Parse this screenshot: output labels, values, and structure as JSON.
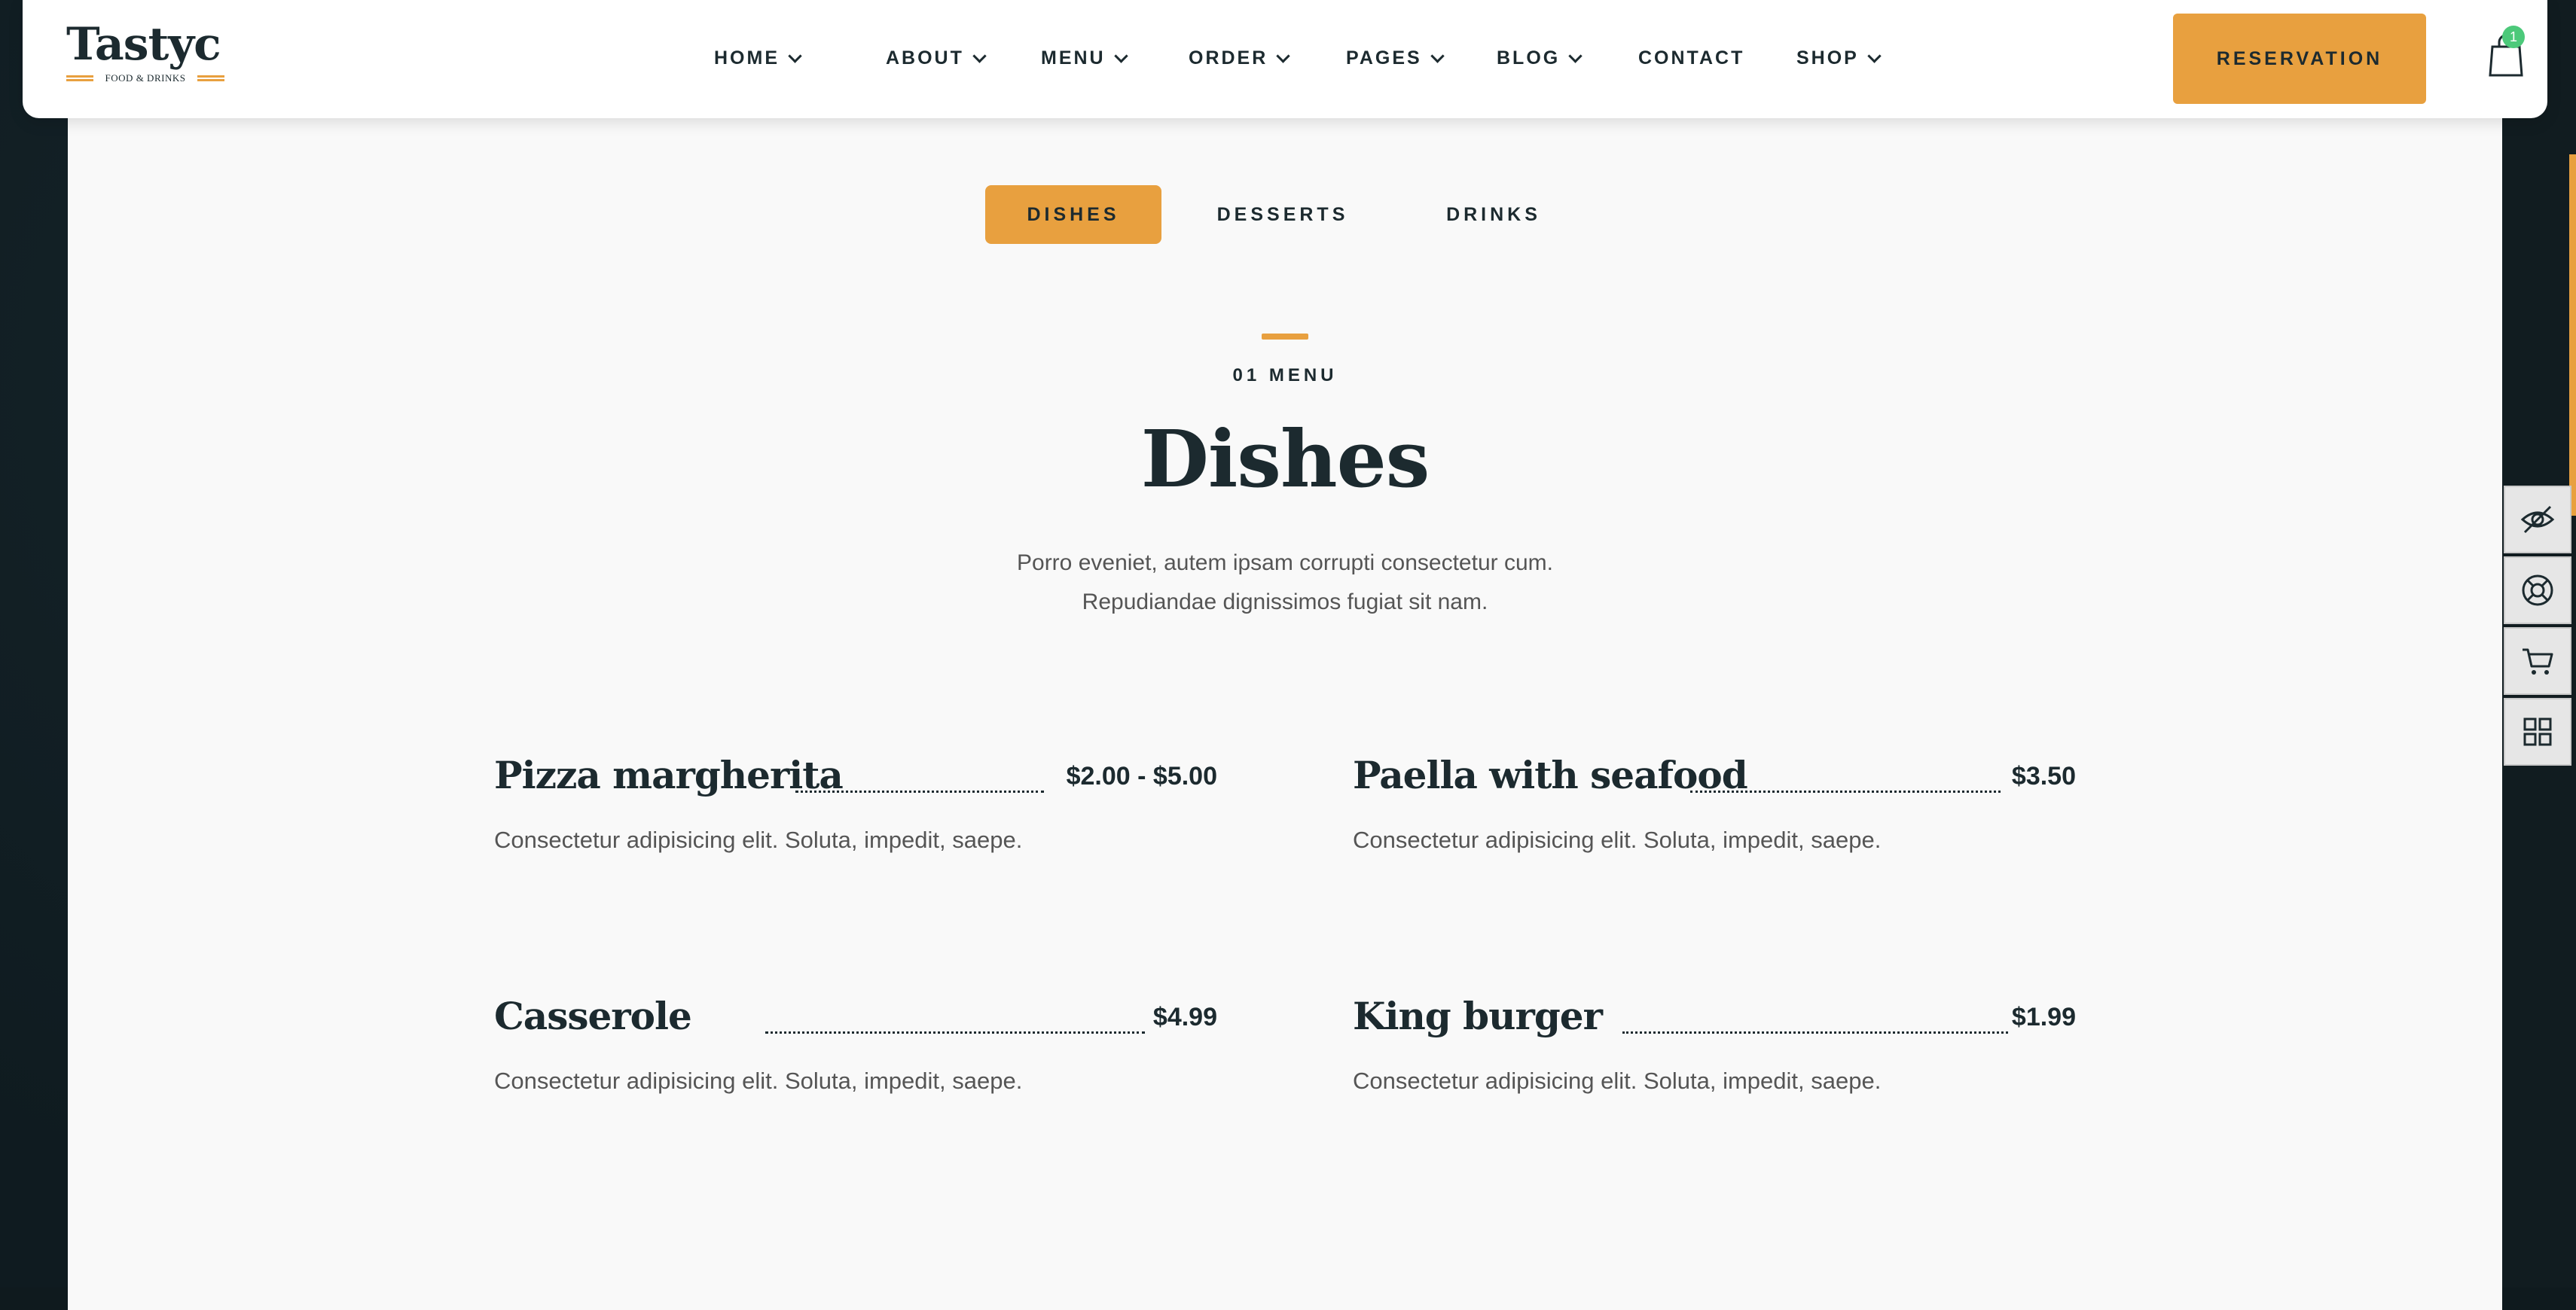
{
  "brand": {
    "name": "Tastyc",
    "tagline": "FOOD & DRINKS"
  },
  "nav": [
    {
      "label": "HOME",
      "has_dropdown": true
    },
    {
      "label": "ABOUT",
      "has_dropdown": true
    },
    {
      "label": "MENU",
      "has_dropdown": true
    },
    {
      "label": "ORDER",
      "has_dropdown": true
    },
    {
      "label": "PAGES",
      "has_dropdown": true
    },
    {
      "label": "BLOG",
      "has_dropdown": true
    },
    {
      "label": "CONTACT",
      "has_dropdown": false
    },
    {
      "label": "SHOP",
      "has_dropdown": true
    }
  ],
  "header": {
    "reservation_label": "RESERVATION",
    "cart_count": "1",
    "cart_icon": "shopping-bag-icon"
  },
  "tabs": [
    {
      "label": "DISHES",
      "active": true
    },
    {
      "label": "DESSERTS",
      "active": false
    },
    {
      "label": "DRINKS",
      "active": false
    }
  ],
  "section": {
    "kicker": "01 MENU",
    "title": "Dishes",
    "description_line1": "Porro eveniet, autem ipsam corrupti consectetur cum.",
    "description_line2": "Repudiandae dignissimos fugiat sit nam."
  },
  "menu_items": [
    {
      "name": "Pizza margherita",
      "price": "$2.00 - $5.00",
      "description": "Consectetur adipisicing elit. Soluta, impedit, saepe."
    },
    {
      "name": "Paella with seafood",
      "price": "$3.50",
      "description": "Consectetur adipisicing elit. Soluta, impedit, saepe."
    },
    {
      "name": "Casserole",
      "price": "$4.99",
      "description": "Consectetur adipisicing elit. Soluta, impedit, saepe."
    },
    {
      "name": "King burger",
      "price": "$1.99",
      "description": "Consectetur adipisicing elit. Soluta, impedit, saepe."
    }
  ],
  "side_toolbar": [
    {
      "icon": "eye-slash-icon"
    },
    {
      "icon": "lifebuoy-icon"
    },
    {
      "icon": "cart-icon"
    },
    {
      "icon": "grid-icon"
    }
  ],
  "colors": {
    "accent": "#e8a03f",
    "text": "#1c2a2f",
    "badge": "#4cc97a",
    "page_bg": "#f9f9f9",
    "backdrop": "#0f1b20"
  }
}
